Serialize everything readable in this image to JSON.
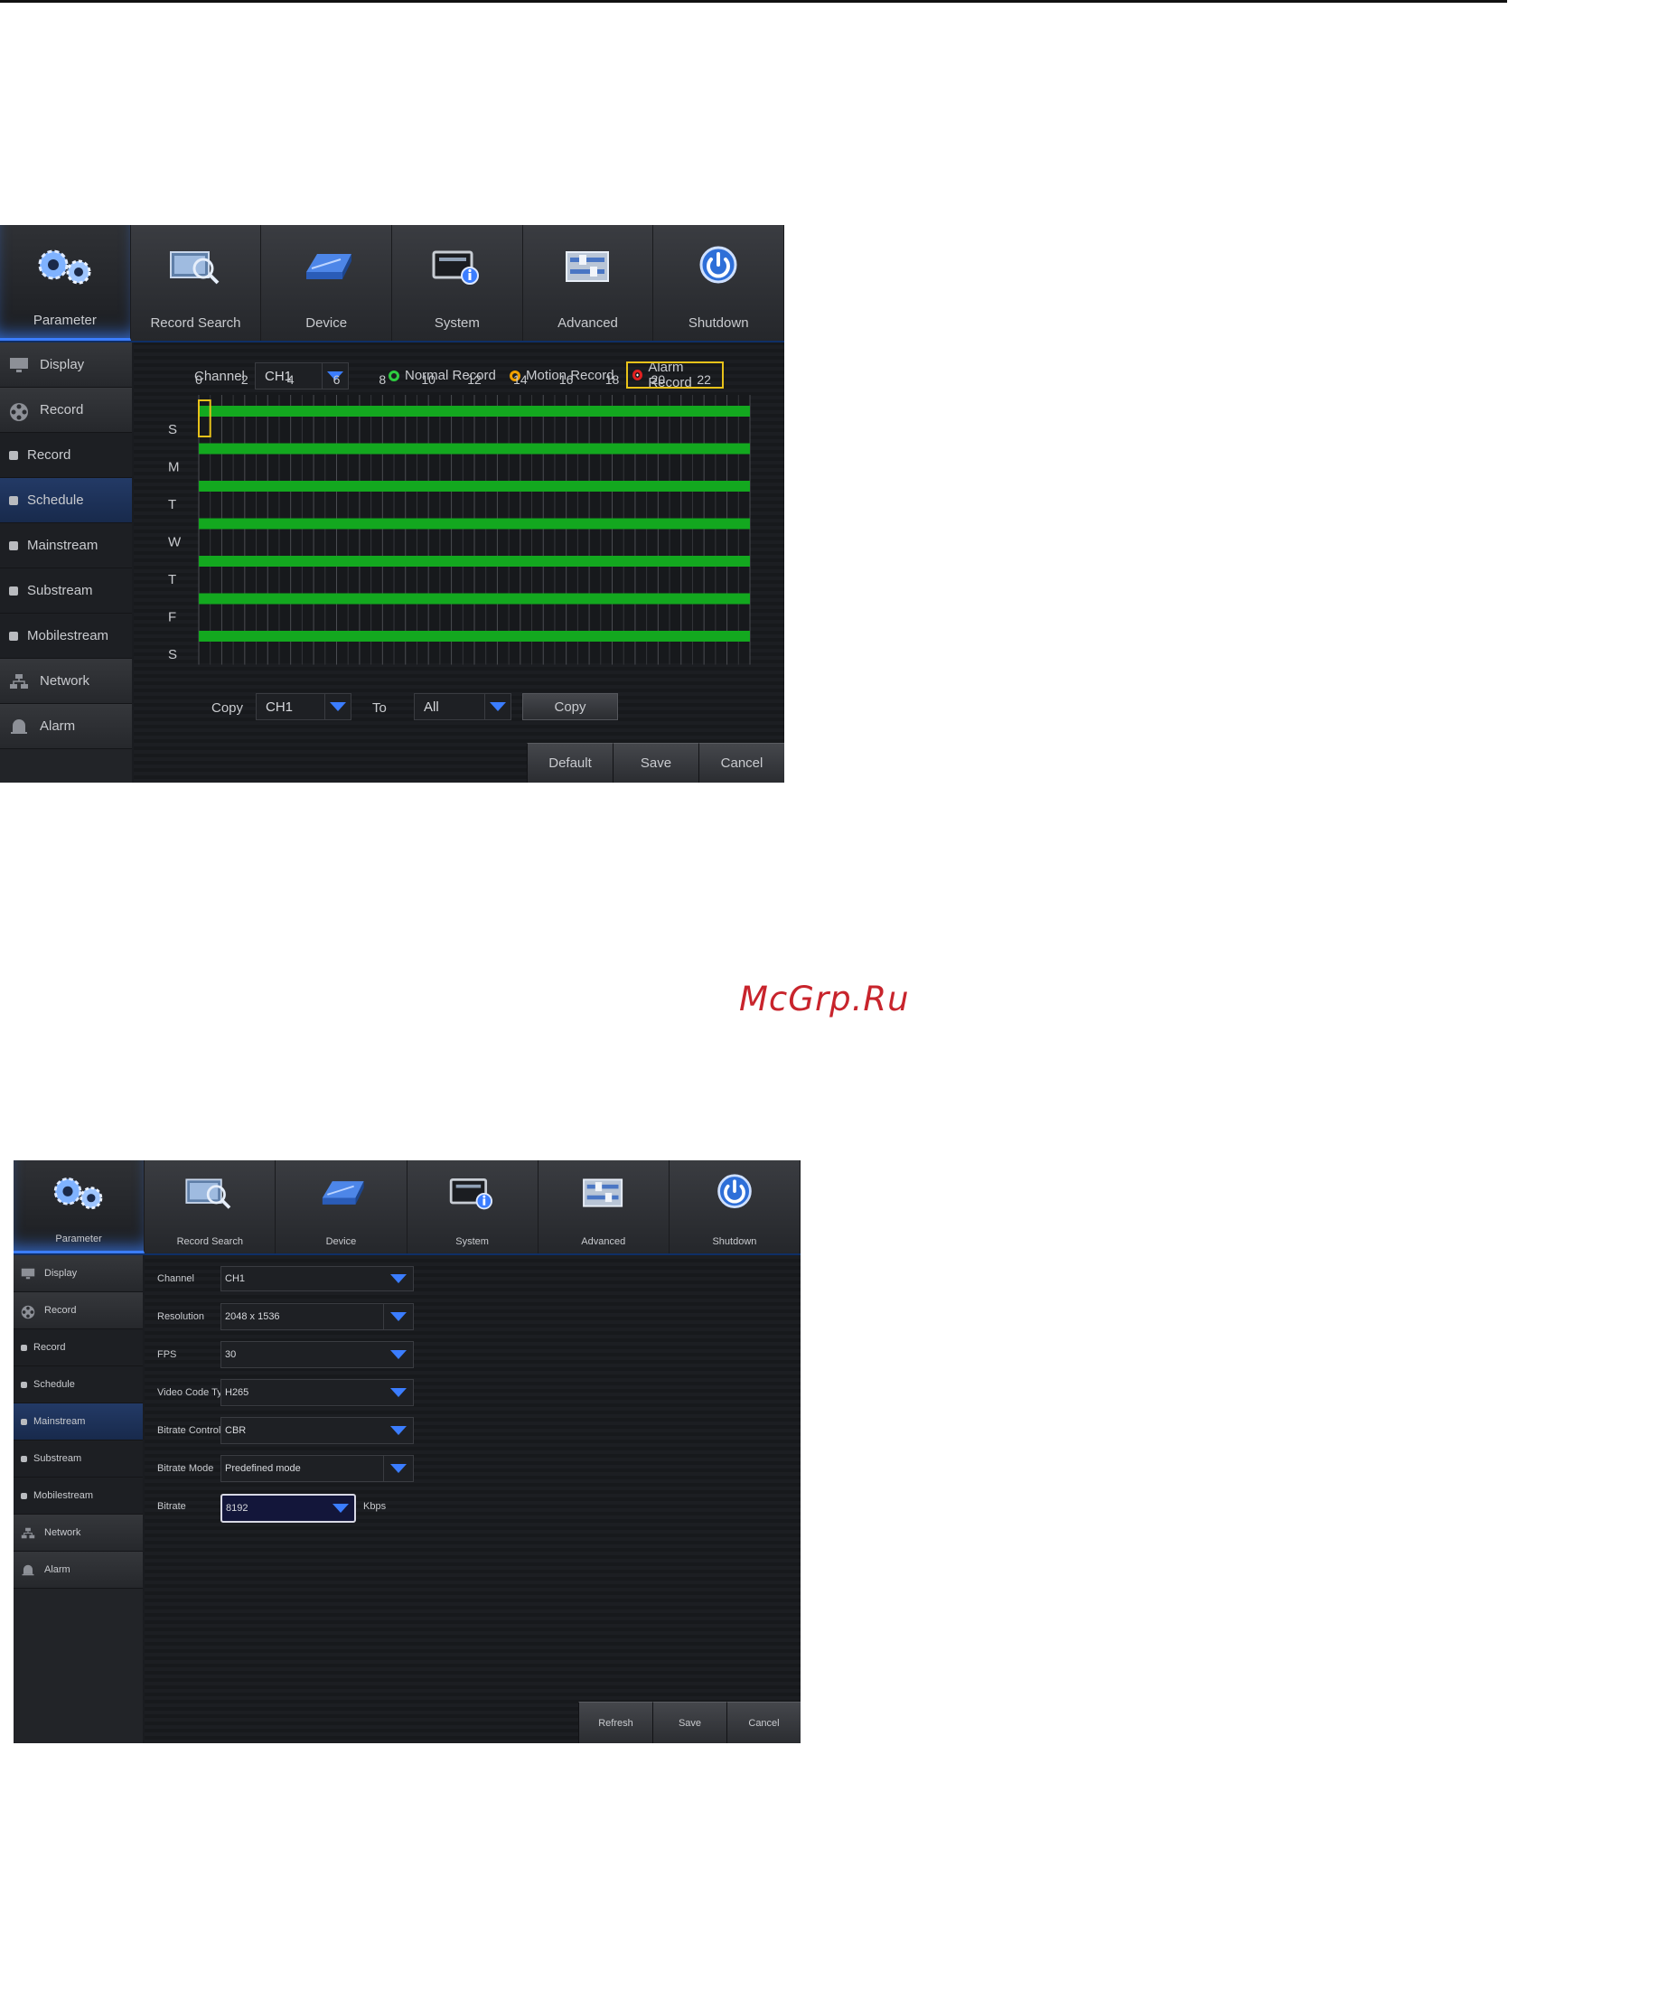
{
  "watermark": "McGrp.Ru",
  "tabs": [
    {
      "label": "Parameter",
      "icon": "gears-icon"
    },
    {
      "label": "Record Search",
      "icon": "record-search-icon"
    },
    {
      "label": "Device",
      "icon": "hard-drive-icon"
    },
    {
      "label": "System",
      "icon": "system-info-icon"
    },
    {
      "label": "Advanced",
      "icon": "sliders-icon"
    },
    {
      "label": "Shutdown",
      "icon": "power-icon"
    }
  ],
  "sidebar": {
    "display": "Display",
    "record": "Record",
    "record_sub": "Record",
    "schedule": "Schedule",
    "mainstream": "Mainstream",
    "substream": "Substream",
    "mobilestream": "Mobilestream",
    "network": "Network",
    "alarm": "Alarm"
  },
  "schedule_panel": {
    "channel_label": "Channel",
    "channel_value": "CH1",
    "legend": {
      "normal": "Normal Record",
      "motion": "Motion Record",
      "alarm": "Alarm Record"
    },
    "legend_colors": {
      "normal": "#2ecc40",
      "motion": "#f0a000",
      "alarm": "#e02020"
    },
    "hours": [
      "0",
      "2",
      "4",
      "6",
      "8",
      "10",
      "12",
      "14",
      "16",
      "18",
      "20",
      "22"
    ],
    "days": [
      "S",
      "M",
      "T",
      "W",
      "T",
      "F",
      "S"
    ],
    "recorded_color": "#13a81f",
    "copy_label": "Copy",
    "copy_value": "CH1",
    "to_label": "To",
    "to_value": "All",
    "copy_button": "Copy",
    "buttons": {
      "default": "Default",
      "save": "Save",
      "cancel": "Cancel"
    }
  },
  "mainstream_panel": {
    "fields": [
      {
        "label": "Channel",
        "value": "CH1"
      },
      {
        "label": "Resolution",
        "value": "2048 x 1536"
      },
      {
        "label": "FPS",
        "value": "30"
      },
      {
        "label": "Video Code Type",
        "value": "H265"
      },
      {
        "label": "Bitrate Control",
        "value": "CBR"
      },
      {
        "label": "Bitrate Mode",
        "value": "Predefined mode"
      }
    ],
    "bitrate_label": "Bitrate",
    "bitrate_value": "8192",
    "bitrate_unit": "Kbps",
    "buttons": {
      "refresh": "Refresh",
      "save": "Save",
      "cancel": "Cancel"
    }
  }
}
